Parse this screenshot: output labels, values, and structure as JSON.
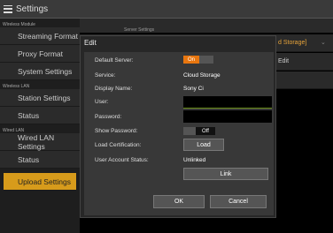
{
  "window": {
    "title": "Settings"
  },
  "sidebar": {
    "sections": [
      {
        "label": "Wireless Module",
        "items": [
          "Streaming Format",
          "Proxy Format",
          "System Settings"
        ]
      },
      {
        "label": "Wireless LAN",
        "items": [
          "Station Settings",
          "Status"
        ]
      },
      {
        "label": "Wired LAN",
        "items": [
          "Wired LAN Settings",
          "Status"
        ]
      }
    ],
    "active_item": "Upload Settings"
  },
  "background": {
    "header_subtitle": "Server Settings",
    "server_value": "d Storage]",
    "edit_label": "Edit"
  },
  "dialog": {
    "title": "Edit",
    "default_server_label": "Default Server:",
    "default_server_value": "On",
    "service_label": "Service:",
    "service_value": "Cloud Storage",
    "display_name_label": "Display Name:",
    "display_name_value": "Sony Ci",
    "user_label": "User:",
    "password_label": "Password:",
    "show_password_label": "Show Password:",
    "show_password_value": "Off",
    "load_cert_label": "Load Certification:",
    "load_button": "Load",
    "account_status_label": "User Account Status:",
    "account_status_value": "Unlinked",
    "link_button": "Link",
    "ok_button": "OK",
    "cancel_button": "Cancel"
  },
  "colors": {
    "accent": "#d79b1b",
    "toggle_on": "#e8760f"
  }
}
